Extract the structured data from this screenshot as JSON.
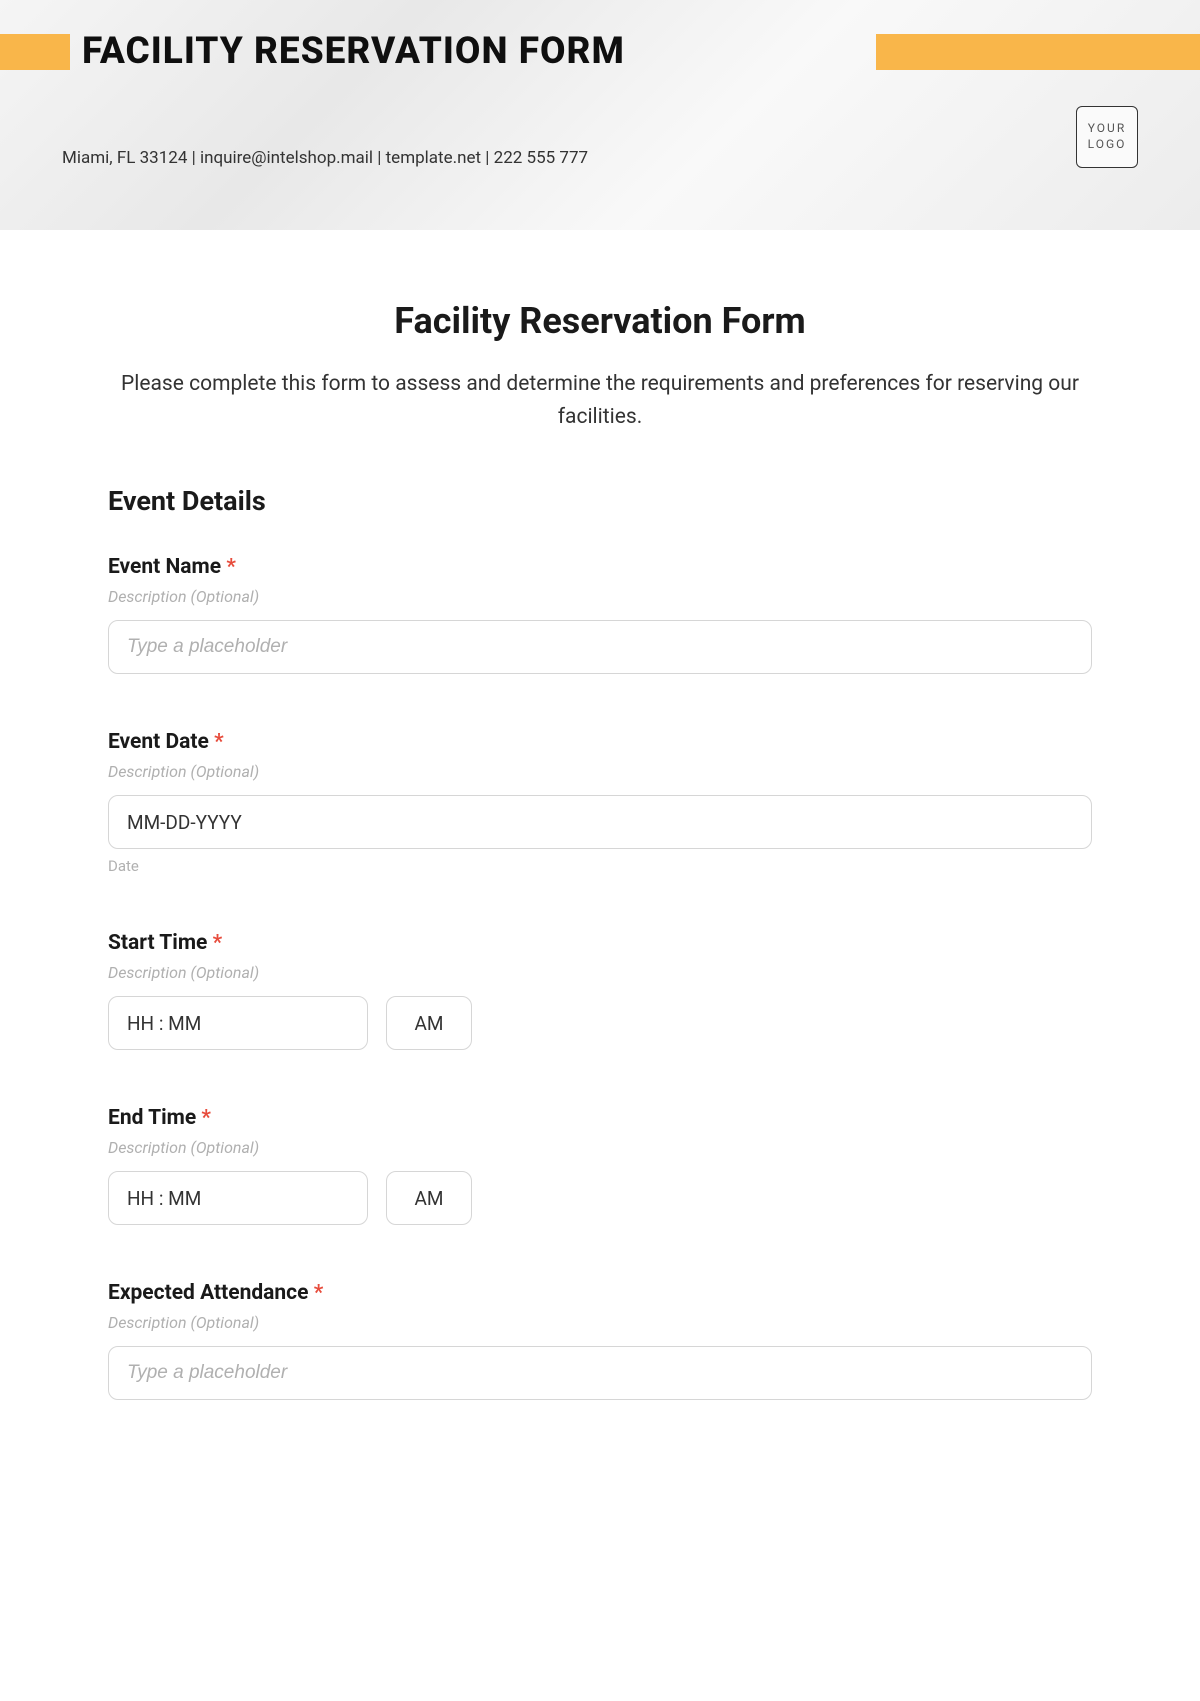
{
  "header": {
    "banner_title": "FACILITY RESERVATION FORM",
    "contact_line": "Miami, FL 33124 | inquire@intelshop.mail | template.net | 222 555 777",
    "logo_line1": "YOUR",
    "logo_line2": "LOGO"
  },
  "form": {
    "title": "Facility Reservation Form",
    "description": "Please complete this form to assess and determine the requirements and preferences for reserving our facilities.",
    "section_heading": "Event Details"
  },
  "fields": {
    "event_name": {
      "label": "Event Name",
      "required": "*",
      "desc": "Description (Optional)",
      "placeholder": "Type a placeholder"
    },
    "event_date": {
      "label": "Event Date",
      "required": "*",
      "desc": "Description (Optional)",
      "value": "MM-DD-YYYY",
      "sub_label": "Date"
    },
    "start_time": {
      "label": "Start Time",
      "required": "*",
      "desc": "Description (Optional)",
      "value": "HH : MM",
      "ampm": "AM"
    },
    "end_time": {
      "label": "End Time",
      "required": "*",
      "desc": "Description (Optional)",
      "value": "HH : MM",
      "ampm": "AM"
    },
    "expected_attendance": {
      "label": "Expected Attendance",
      "required": "*",
      "desc": "Description (Optional)",
      "placeholder": "Type a placeholder"
    }
  }
}
